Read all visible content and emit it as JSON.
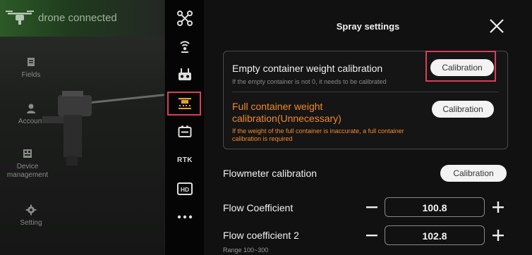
{
  "topbar": {
    "status_text": "drone connected"
  },
  "sidebar": {
    "items": [
      {
        "label": "Fields"
      },
      {
        "label": "Account"
      },
      {
        "label": "Device management"
      },
      {
        "label": "Setting"
      }
    ]
  },
  "iconbar": {
    "rtk_label": "RTK",
    "hd_label": "HD"
  },
  "panel": {
    "title": "Spray settings",
    "empty_container": {
      "title": "Empty container weight calibration",
      "desc": "If the empty container is not 0, it needs to be calibrated",
      "button": "Calibration"
    },
    "full_container": {
      "title_line1": "Full container weight",
      "title_line2": "calibration(Unnecessary)",
      "desc_line1": "If the weight of the full container is inaccurate, a full container",
      "desc_line2": "calibration is required",
      "button": "Calibration"
    },
    "flowmeter": {
      "title": "Flowmeter calibration",
      "button": "Calibration"
    },
    "flow_coefficient": {
      "label": "Flow Coefficient",
      "value": "100.8"
    },
    "flow_coefficient_2": {
      "label": "Flow coefficient 2",
      "value": "102.8",
      "range": "Range 100~300"
    }
  },
  "colors": {
    "accent_orange": "#f08a2c",
    "highlight_red": "#d93e5b",
    "connected_green": "#2c5a27"
  }
}
